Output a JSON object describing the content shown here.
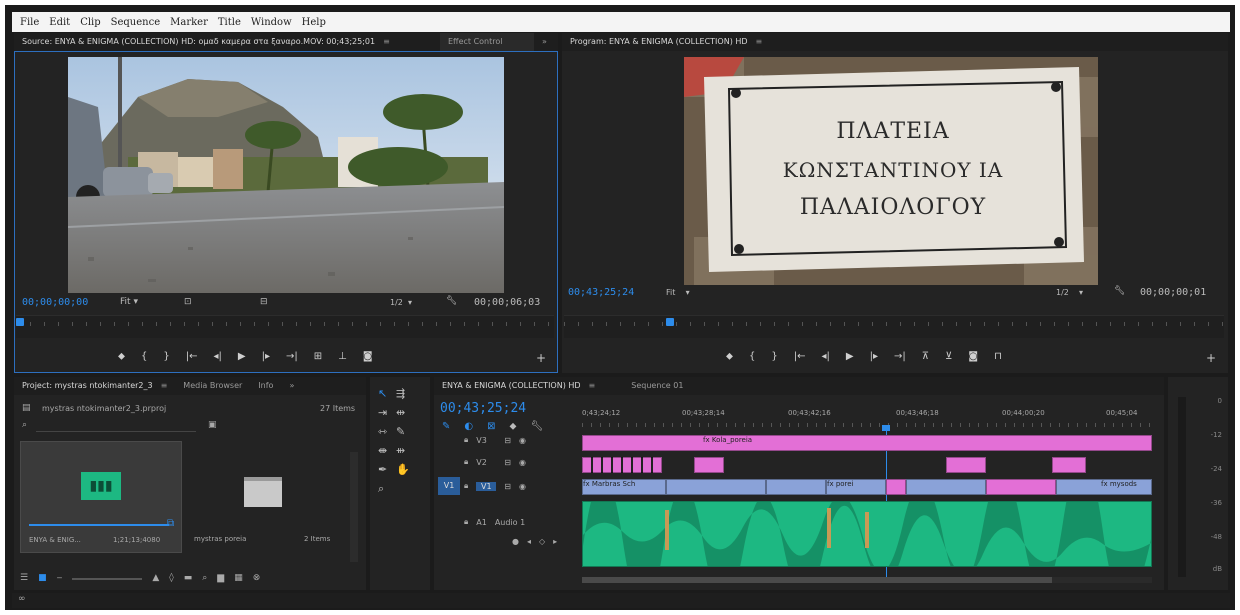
{
  "menu": [
    "File",
    "Edit",
    "Clip",
    "Sequence",
    "Marker",
    "Title",
    "Window",
    "Help"
  ],
  "source": {
    "tab_title": "Source: ENYA & ENIGMA (COLLECTION) HD: ομαδ καμερα στα ξαναρο.MOV: 00;43;25;01",
    "tab_close": "≡",
    "effect_tab": "Effect Control",
    "effect_more": "»",
    "timecode": "00;00;00;00",
    "fit": "Fit",
    "ratio": "1/2",
    "duration": "00;00;06;03"
  },
  "program": {
    "tab_title": "Program: ENYA & ENIGMA (COLLECTION) HD",
    "tab_close": "≡",
    "timecode": "00;43;25;24",
    "fit": "Fit",
    "ratio": "1/2",
    "duration": "00;00;00;01",
    "sign_lines": [
      "ΠΛΑΤΕΙΑ",
      "ΚΩΝΣΤΑΝΤΙΝΟΥ ΙΑ",
      "ΠΑΛΑΙΟΛΟΓΟΥ"
    ]
  },
  "project": {
    "tab_title": "Project: mystras ntokimanter2_3",
    "tab_close": "≡",
    "tab2": "Media Browser",
    "tab3": "Info",
    "tab_more": "»",
    "file_name": "mystras ntokimanter2_3.prproj",
    "count": "27 Items",
    "item1_name": "ENYA & ENIG...",
    "item1_dur": "1;21;13;4080",
    "item2_name": "mystras poreia",
    "item2_count": "2 Items"
  },
  "timeline": {
    "tab_title": "ENYA & ENIGMA (COLLECTION) HD",
    "tab_close": "≡",
    "tab2": "Sequence 01",
    "timecode": "00;43;25;24",
    "ruler": [
      "0;43;24;12",
      "00;43;28;14",
      "00;43;42;16",
      "00;43;46;18",
      "00;44;00;20",
      "00;45;04"
    ],
    "tracks": {
      "v3": "V3",
      "v2": "V2",
      "v1": "V1",
      "v1_src": "V1",
      "a1": "A1",
      "a1_name": "Audio 1"
    },
    "clip_labels": {
      "v3_main": "fx Kola_poreia",
      "v1_first": "fx Marbras Sch",
      "v1_mid": "fx porei",
      "v1_last": "fx mysods"
    }
  },
  "meter_labels": [
    "0",
    "-12",
    "-24",
    "-36",
    "-48",
    "dB"
  ],
  "status": "∞",
  "colors": {
    "accent": "#2d8ceb",
    "video_pink": "#e36fd6",
    "video_blue": "#8aa2d8",
    "audio_green": "#1db882"
  }
}
